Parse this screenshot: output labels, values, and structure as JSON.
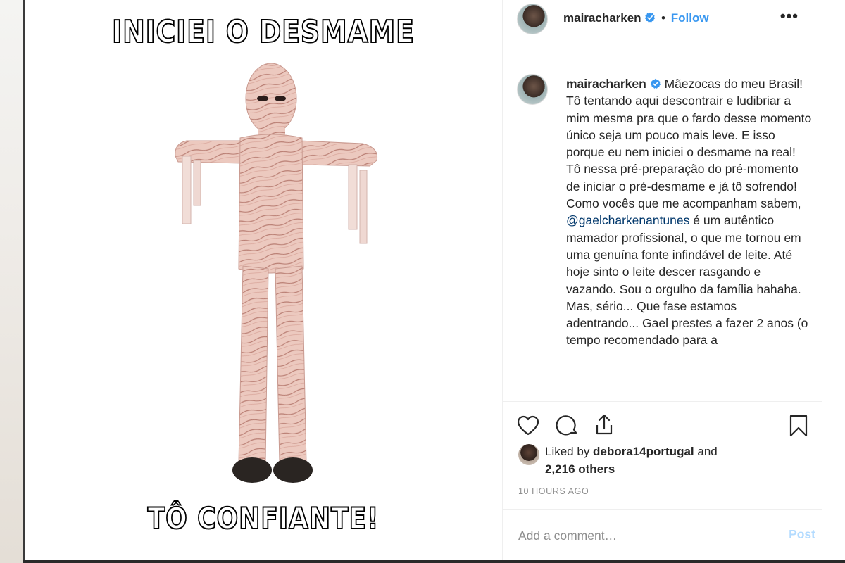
{
  "media": {
    "top_text": "INICIEI O DESMAME",
    "bottom_text": "TÔ CONFIANTE!"
  },
  "header": {
    "username": "mairacharken",
    "separator": "•",
    "follow_label": "Follow",
    "more_label": "•••"
  },
  "caption": {
    "username": "mairacharken",
    "text_before_mention": " Mãezocas do meu Brasil! Tô tentando aqui descontrair e ludibriar a mim mesma pra que o fardo desse momento único seja um pouco mais leve. E isso porque eu nem iniciei o desmame na real! Tô nessa pré-preparação do pré-momento de iniciar o pré-desmame e já tô sofrendo! Como vocês que me acompanham sabem, ",
    "mention": "@gaelcharkenantunes",
    "text_after_mention": " é um autêntico mamador profissional, o que me tornou em uma genuína fonte infindável de leite. Até hoje sinto o leite descer rasgando e vazando. Sou o orgulho da família hahaha. Mas, sério... Que fase estamos adentrando... Gael prestes a fazer 2 anos (o tempo recomendado para a"
  },
  "likes": {
    "prefix": "Liked by ",
    "user": "debora14portugal",
    "middle": " and ",
    "others": "2,216 others"
  },
  "timestamp": "10 HOURS AGO",
  "comment": {
    "placeholder": "Add a comment…",
    "post_label": "Post"
  },
  "icons": [
    "verified-badge-icon",
    "heart-icon",
    "comment-icon",
    "share-icon",
    "bookmark-icon",
    "more-options-icon"
  ],
  "colors": {
    "link_blue": "#3897f0",
    "mention": "#00376b",
    "muted": "#8e8e8e",
    "post_disabled": "#b3dbff"
  }
}
